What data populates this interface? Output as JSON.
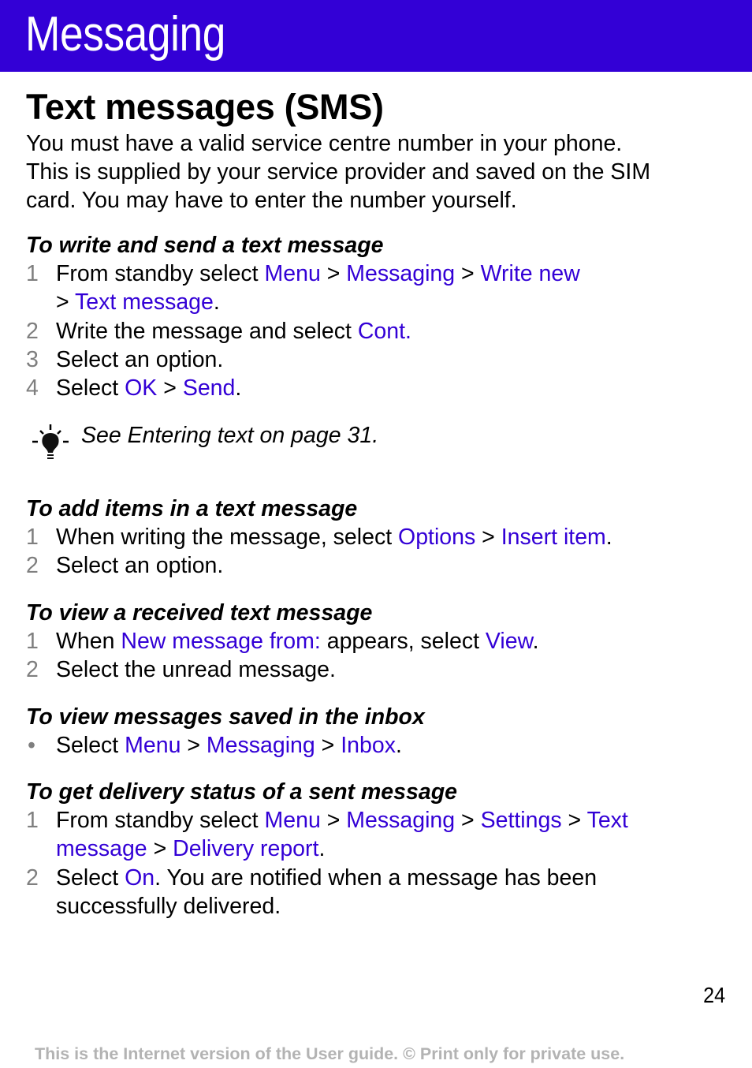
{
  "header": {
    "title": "Messaging",
    "banner_color": "#3300d6"
  },
  "section": {
    "title": "Text messages (SMS)",
    "intro_lines": [
      "You must have a valid service centre number in your phone.",
      "This is supplied by your service provider and saved on the SIM",
      "card. You may have to enter the number yourself."
    ]
  },
  "write_send": {
    "heading": "To write and send a text message",
    "steps": [
      {
        "num": "1",
        "t1": "From standby select ",
        "a": "Menu",
        "s1": " > ",
        "b": "Messaging",
        "s2": " > ",
        "c": "Write new",
        "line2_prefix": "> ",
        "d": "Text message",
        "end": "."
      },
      {
        "num": "2",
        "t1": "Write the message and select ",
        "a": "Cont."
      },
      {
        "num": "3",
        "t1": "Select an option."
      },
      {
        "num": "4",
        "t1": "Select ",
        "a": "OK",
        "s1": " > ",
        "b": "Send",
        "end": "."
      }
    ]
  },
  "tip": {
    "icon": "lightbulb-icon",
    "text": "See Entering text on page 31."
  },
  "add_items": {
    "heading": "To add items in a text message",
    "steps": [
      {
        "num": "1",
        "t1": "When writing the message, select ",
        "a": "Options",
        "s1": " > ",
        "b": "Insert item",
        "end": "."
      },
      {
        "num": "2",
        "t1": "Select an option."
      }
    ]
  },
  "view_received": {
    "heading": "To view a received text message",
    "steps": [
      {
        "num": "1",
        "t1": "When ",
        "a": "New message from:",
        "t2": " appears, select ",
        "b": "View",
        "end": "."
      },
      {
        "num": "2",
        "t1": "Select the unread message."
      }
    ]
  },
  "view_inbox": {
    "heading": "To view messages saved in the inbox",
    "bullet": "•",
    "t1": "Select ",
    "a": "Menu",
    "s1": " > ",
    "b": "Messaging",
    "s2": " > ",
    "c": "Inbox",
    "end": "."
  },
  "delivery": {
    "heading": "To get delivery status of a sent message",
    "steps": [
      {
        "num": "1",
        "t1": "From standby select ",
        "a": "Menu",
        "s1": " > ",
        "b": "Messaging",
        "s2": " > ",
        "c": "Settings",
        "s3": " > ",
        "d": "Text",
        "line2": "message",
        "s4": " > ",
        "e": "Delivery report",
        "end": "."
      },
      {
        "num": "2",
        "t1": "Select ",
        "a": "On",
        "t2": ". You are notified when a message has been",
        "line2": "successfully delivered."
      }
    ]
  },
  "page_number": "24",
  "footer": "This is the Internet version of the User guide. © Print only for private use."
}
